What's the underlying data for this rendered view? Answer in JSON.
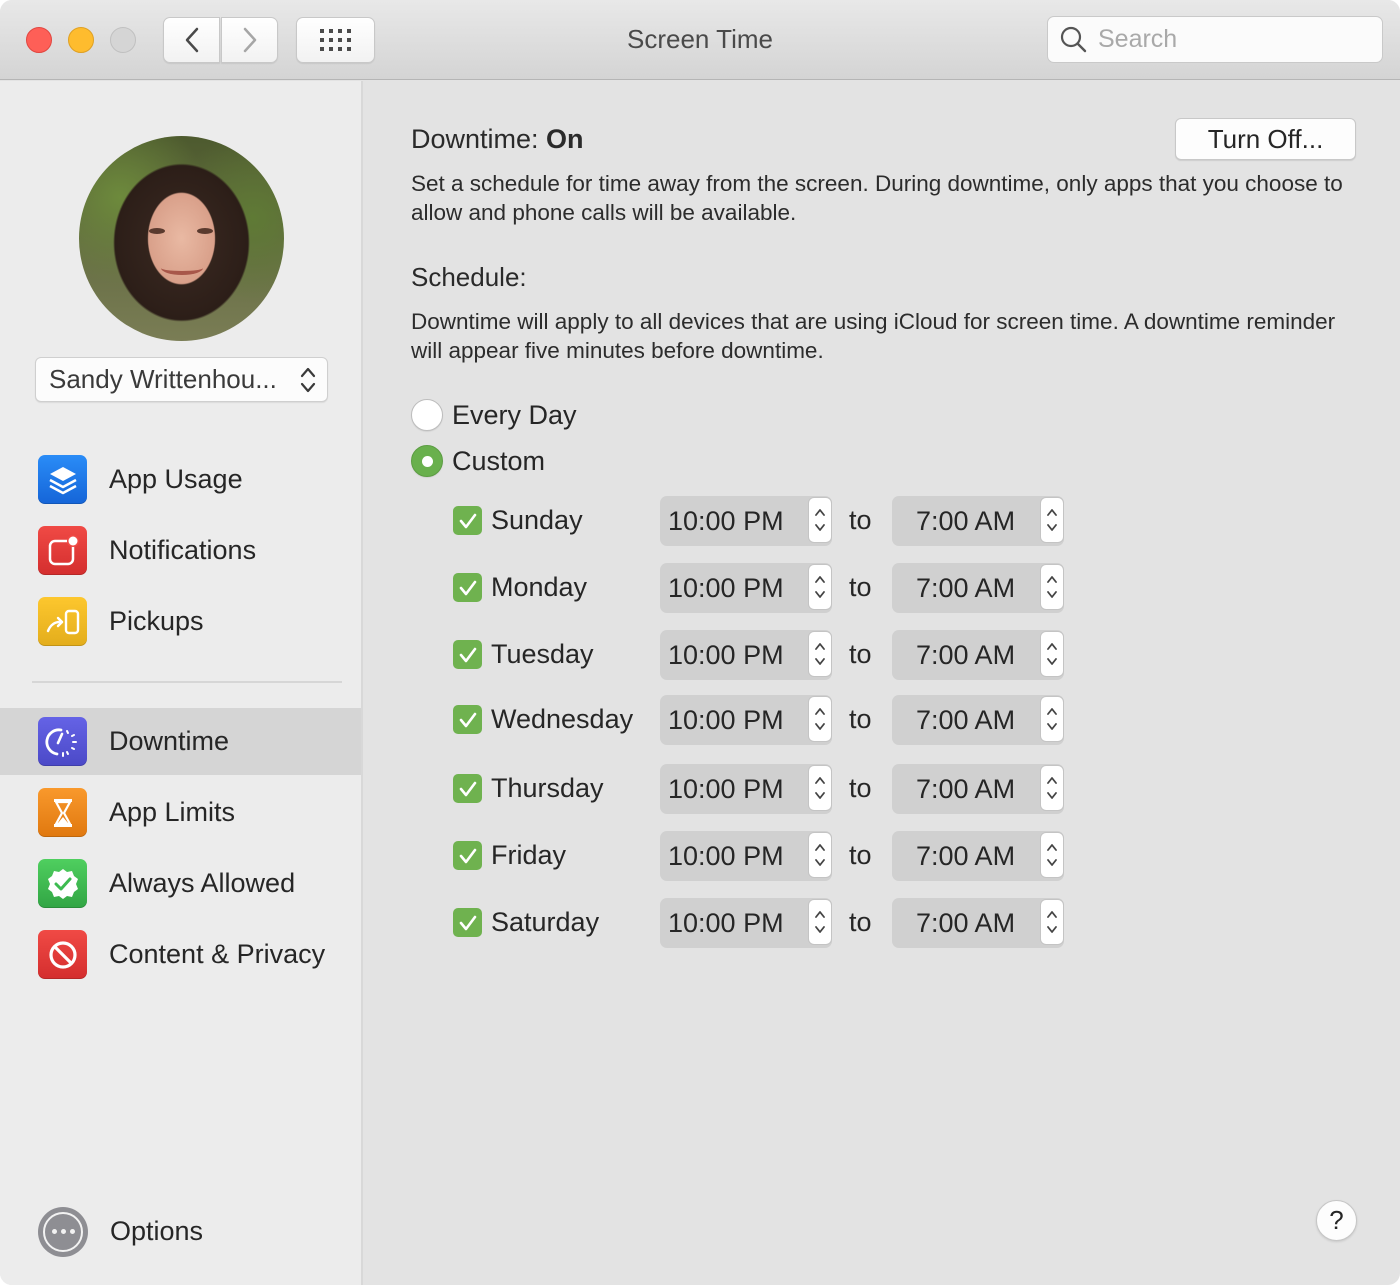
{
  "window": {
    "title": "Screen Time",
    "traffic_lights": [
      "close",
      "minimize",
      "zoom-disabled"
    ]
  },
  "toolbar": {
    "back_icon": "chevron-left-icon",
    "forward_icon": "chevron-right-icon",
    "grid_icon": "show-all-grid-icon",
    "search": {
      "placeholder": "Search",
      "value": ""
    }
  },
  "sidebar": {
    "user": {
      "name": "Sandy Writtenhou..."
    },
    "items": [
      {
        "label": "App Usage",
        "icon": "layers-icon",
        "color": "#1a73e8"
      },
      {
        "label": "Notifications",
        "icon": "notification-badge-icon",
        "color": "#e23b3b"
      },
      {
        "label": "Pickups",
        "icon": "pickup-phone-icon",
        "color": "#f0b323"
      },
      {
        "label": "Downtime",
        "icon": "downtime-clock-icon",
        "color": "#5856d6",
        "selected": true
      },
      {
        "label": "App Limits",
        "icon": "hourglass-icon",
        "color": "#f08a1c"
      },
      {
        "label": "Always Allowed",
        "icon": "checkmark-seal-icon",
        "color": "#3fb950"
      },
      {
        "label": "Content & Privacy",
        "icon": "prohibited-icon",
        "color": "#e23b3b"
      }
    ],
    "options_label": "Options"
  },
  "main": {
    "heading_prefix": "Downtime: ",
    "heading_state": "On",
    "turn_off_label": "Turn Off...",
    "description": "Set a schedule for time away from the screen. During downtime, only apps that you choose to allow and phone calls will be available.",
    "schedule_title": "Schedule:",
    "schedule_description": "Downtime will apply to all devices that are using iCloud for screen time. A downtime reminder will appear five minutes before downtime.",
    "radio_options": [
      {
        "label": "Every Day",
        "selected": false
      },
      {
        "label": "Custom",
        "selected": true
      }
    ],
    "to_label": "to",
    "days": [
      {
        "day": "Sunday",
        "checked": true,
        "from": "10:00 PM",
        "to": "7:00 AM"
      },
      {
        "day": "Monday",
        "checked": true,
        "from": "10:00 PM",
        "to": "7:00 AM"
      },
      {
        "day": "Tuesday",
        "checked": true,
        "from": "10:00 PM",
        "to": "7:00 AM"
      },
      {
        "day": "Wednesday",
        "checked": true,
        "from": "10:00 PM",
        "to": "7:00 AM"
      },
      {
        "day": "Thursday",
        "checked": true,
        "from": "10:00 PM",
        "to": "7:00 AM"
      },
      {
        "day": "Friday",
        "checked": true,
        "from": "10:00 PM",
        "to": "7:00 AM"
      },
      {
        "day": "Saturday",
        "checked": true,
        "from": "10:00 PM",
        "to": "7:00 AM"
      }
    ],
    "help_label": "?"
  },
  "colors": {
    "accent_green": "#6fb24f",
    "selected_row": "#d5d5d5"
  }
}
